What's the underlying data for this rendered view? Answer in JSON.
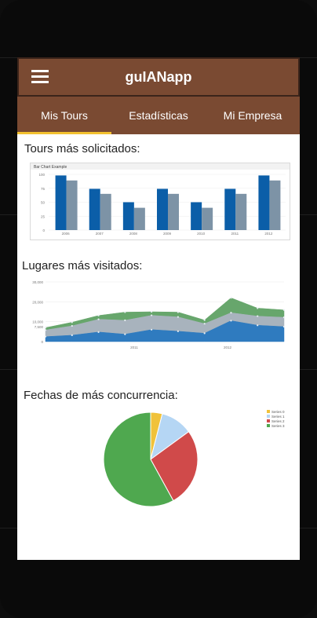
{
  "app": {
    "title": "guIANapp"
  },
  "tabs": [
    {
      "label": "Mis Tours",
      "active": true
    },
    {
      "label": "Estadísticas",
      "active": false
    },
    {
      "label": "Mi Empresa",
      "active": false
    }
  ],
  "colors": {
    "appbar": "#7a4a32",
    "tab_indicator": "#f3c12f"
  },
  "sections": {
    "tours": {
      "title": "Tours más solicitados:"
    },
    "lugares": {
      "title": "Lugares más visitados:"
    },
    "fechas": {
      "title": "Fechas de más concurrencia:"
    }
  },
  "chart_data": [
    {
      "type": "bar",
      "title": "Bar Chart Example",
      "categories": [
        "2006",
        "2007",
        "2008",
        "2009",
        "2010",
        "2011",
        "2012"
      ],
      "ylim": [
        0,
        100
      ],
      "yticks": [
        "0",
        "25",
        "50",
        "75",
        "100"
      ],
      "series": [
        {
          "values": [
            98,
            74,
            50,
            74,
            50,
            74,
            98
          ],
          "color": "#0b5ea8"
        },
        {
          "values": [
            89,
            65,
            40,
            65,
            40,
            65,
            89
          ],
          "color": "#7d93a6"
        }
      ]
    },
    {
      "type": "area",
      "xlabels": [
        "2011",
        "2012"
      ],
      "ylim": [
        0,
        30000
      ],
      "yticks": [
        "0",
        "7,500",
        "10,000",
        "20,000",
        "30,000"
      ],
      "series": [
        {
          "values": [
            2500,
            3200,
            4800,
            3700,
            6000,
            5200,
            4200,
            10500,
            8200,
            7500
          ],
          "color": "#2f7bbf"
        },
        {
          "values": [
            3300,
            4700,
            6400,
            7000,
            7200,
            7200,
            4800,
            4000,
            4600,
            4700
          ],
          "color": "#a8b3bd"
        },
        {
          "values": [
            1200,
            1800,
            1900,
            4100,
            1800,
            2400,
            1800,
            7500,
            4000,
            3700
          ],
          "color": "#67a66c"
        }
      ]
    },
    {
      "type": "pie",
      "legend": [
        "Series 0",
        "Series 1",
        "Series 2",
        "Series 3"
      ],
      "values": [
        4,
        11,
        27,
        58
      ],
      "colors": [
        "#f0c23a",
        "#b5d6f4",
        "#d04a4a",
        "#4fa84f"
      ]
    }
  ]
}
